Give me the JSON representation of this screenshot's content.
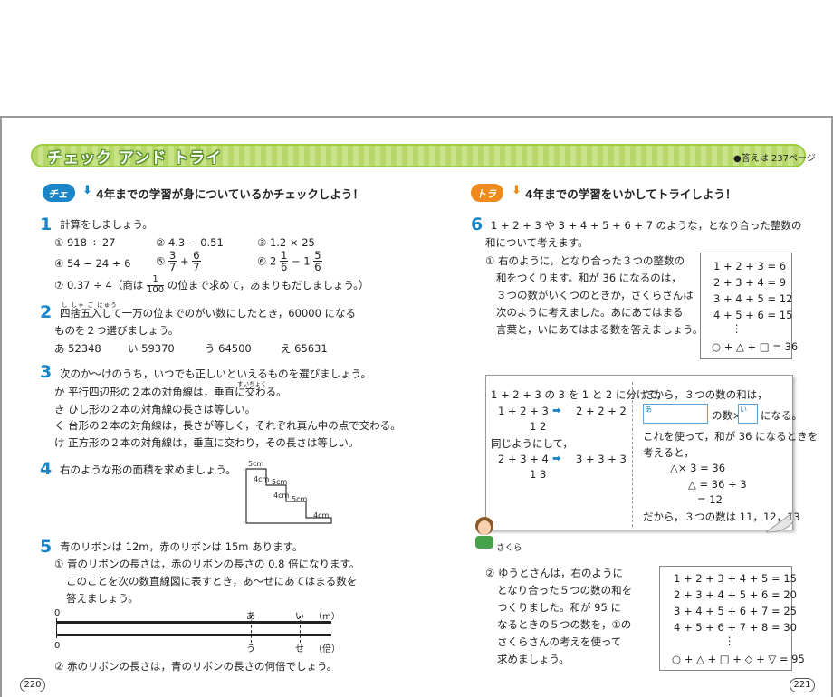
{
  "banner": {
    "title": "チェック アンド トライ",
    "answer_ref": "●答えは 237ページ"
  },
  "check": {
    "badge": "チェック",
    "arrow": "⬇",
    "subtitle": "4年までの学習が身についているかチェックしよう！"
  },
  "try": {
    "badge": "トライ",
    "arrow": "⬇",
    "subtitle": "4年までの学習をいかしてトライしよう！"
  },
  "q1": {
    "num": "1",
    "prompt": "計算をしましょう。",
    "i1": "① 918 ÷ 27",
    "i2": "② 4.3 − 0.51",
    "i3": "③ 1.2 × 25",
    "i4": "④ 54 − 24 ÷ 6",
    "i5_label": "⑤",
    "i5_a_num": "3",
    "i5_a_den": "7",
    "i5_op": "+",
    "i5_b_num": "6",
    "i5_b_den": "7",
    "i6_label": "⑥ 2",
    "i6_a_num": "1",
    "i6_a_den": "6",
    "i6_op": "− 1",
    "i6_b_num": "5",
    "i6_b_den": "6",
    "i7_pre": "⑦ 0.37 ÷ 4（商は",
    "i7_num": "1",
    "i7_den": "100",
    "i7_post": "の位まで求めて，あまりもだしましょう。）"
  },
  "q2": {
    "num": "2",
    "ruby": "し しゃ ご にゅう",
    "line1": "四捨五入して一万の位までのがい数にしたとき，60000 になる",
    "line2": "ものを２つ選びましょう。",
    "opts": [
      "あ 52348",
      "い 59370",
      "う 64500",
      "え 65631"
    ]
  },
  "q3": {
    "num": "3",
    "prompt": "次のか〜けのうち，いつでも正しいといえるものを選びましょう。",
    "ruby": "すいちょく",
    "items": [
      "か 平行四辺形の２本の対角線は，垂直に交わる。",
      "き ひし形の２本の対角線の長さは等しい。",
      "く 台形の２本の対角線は，長さが等しく，それぞれ真ん中の点で交わる。",
      "け 正方形の２本の対角線は，垂直に交わり，その長さは等しい。"
    ]
  },
  "q4": {
    "num": "4",
    "prompt": "右のような形の面積を求めましょう。",
    "labels": [
      "5cm",
      "4cm",
      "5cm",
      "4cm",
      "5cm",
      "4cm"
    ]
  },
  "q5": {
    "num": "5",
    "prompt": "青のリボンは 12m，赤のリボンは 15m あります。",
    "p1_line1": "① 青のリボンの長さは，赤のリボンの長さの 0.8 倍になります。",
    "p1_line2": "このことを次の数直線図に表すとき，あ〜せにあてはまる数を",
    "p1_line3": "答えましょう。",
    "top_zero": "0",
    "top_a": "あ",
    "top_b": "い",
    "top_unit": "（m）",
    "bot_zero": "0",
    "bot_a": "う",
    "bot_b": "せ",
    "bot_unit": "（倍）",
    "p2": "② 赤のリボンの長さは，青のリボンの長さの何倍でしょう。"
  },
  "q6": {
    "num": "6",
    "line1": "1 + 2 + 3 や 3 + 4 + 5 + 6 + 7 のような，となり合った整数の",
    "line2": "和について考えます。",
    "p1": [
      "① 右のように，となり合った３つの整数の",
      "和をつくります。和が 36 になるのは，",
      "３つの数がいくつのときか，さくらさんは",
      "次のように考えました。あにあてはまる",
      "言葉と，いにあてはまる数を答えましょう。"
    ],
    "box1": [
      "1 + 2 + 3 = 6",
      "2 + 3 + 4 = 9",
      "3 + 4 + 5 = 12",
      "4 + 5 + 6 = 15",
      "⋮",
      "○ + △ + □ = 36"
    ],
    "note_left": {
      "l1": "1 + 2 + 3 の 3 を 1 と 2 に分けて，",
      "l2a": "1 + 2 + 3",
      "arrow": "➡",
      "l2b": "2 + 2 + 2",
      "l3": "1  2",
      "l4": "同じようにして，",
      "l5a": "2 + 3 + 4",
      "l5b": "3 + 3 + 3",
      "l6": "1  3"
    },
    "note_right": {
      "l1": "だから，３つの数の和は，",
      "lbl_a": "あ",
      "mid": "の数×",
      "lbl_b": "い",
      "end": "になる。",
      "l3": "これを使って，和が 36 になるときを",
      "l4": "考えると，",
      "l5": "△× 3 = 36",
      "l6": "△ = 36 ÷ 3",
      "l7": "= 12",
      "l8": "だから，３つの数は 11，12，13"
    },
    "person": "さくら",
    "p2": [
      "② ゆうとさんは，右のように",
      "となり合った５つの数の和を",
      "つくりました。和が 95 に",
      "なるときの５つの数を，①の",
      "さくらさんの考えを使って",
      "求めましょう。"
    ],
    "box2": [
      "1 + 2 + 3 + 4 + 5 = 15",
      "2 + 3 + 4 + 5 + 6 = 20",
      "3 + 4 + 5 + 6 + 7 = 25",
      "4 + 5 + 6 + 7 + 8 = 30",
      "⋮",
      "○ + △ + □ + ◇ + ▽ = 95"
    ]
  },
  "pages": {
    "left": "220",
    "right": "221"
  }
}
